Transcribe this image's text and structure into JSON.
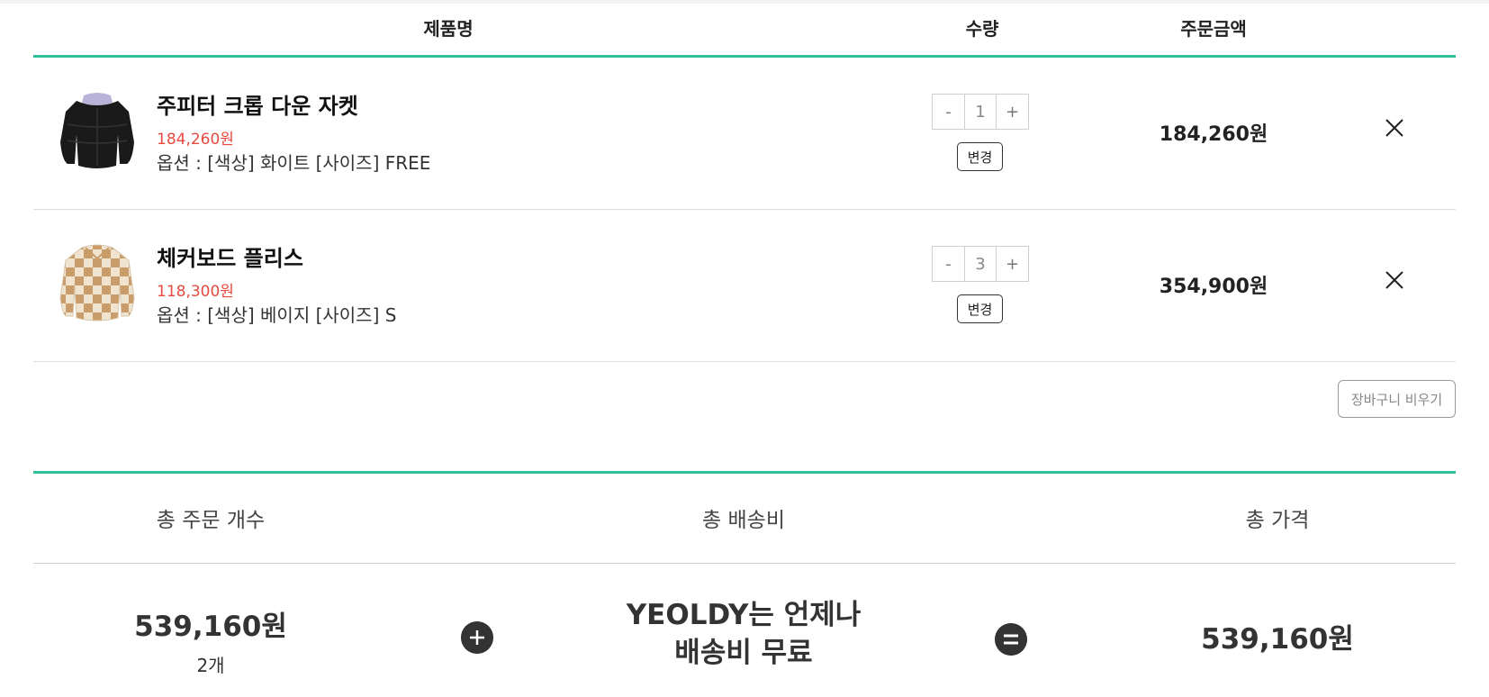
{
  "table_header": {
    "product": "제품명",
    "quantity": "수량",
    "amount": "주문금액"
  },
  "items": [
    {
      "name": "주피터 크롭 다운 자켓",
      "price": "184,260원",
      "option": "옵션 : [색상] 화이트 [사이즈] FREE",
      "quantity": "1",
      "amount": "184,260원",
      "thumbnail": "black-puffer-jacket-image"
    },
    {
      "name": "체커보드 플리스",
      "price": "118,300원",
      "option": "옵션 : [색상] 베이지 [사이즈] S",
      "quantity": "3",
      "amount": "354,900원",
      "thumbnail": "checkerboard-fleece-image"
    }
  ],
  "controls": {
    "minus": "-",
    "plus": "+",
    "change_label": "변경",
    "remove_icon": "close-icon",
    "empty_cart_label": "장바구니 비우기"
  },
  "summary": {
    "count_label": "총 주문 개수",
    "shipping_label": "총 배송비",
    "total_label": "총 가격",
    "order_amount": "539,160원",
    "item_count": "2개",
    "shipping_line1": "YEOLDY는 언제나",
    "shipping_line2": "배송비 무료",
    "total_amount": "539,160원"
  },
  "colors": {
    "accent": "#2fbf9a",
    "price_red": "#e84a3f",
    "text_dark": "#222222"
  }
}
